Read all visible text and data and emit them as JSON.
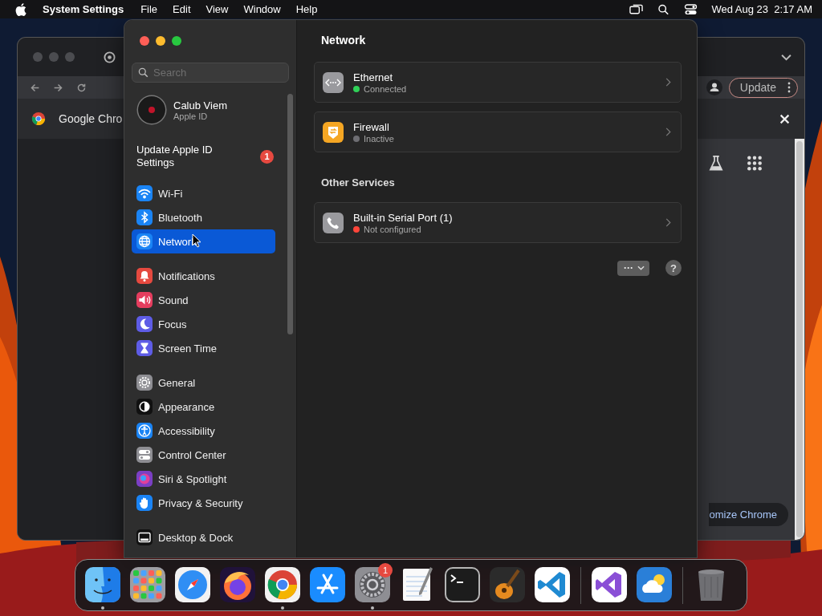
{
  "menu_bar": {
    "app_name": "System Settings",
    "menus": [
      "File",
      "Edit",
      "View",
      "Window",
      "Help"
    ],
    "clock": "Wed Aug 23  2:17 AM"
  },
  "browser_window": {
    "bookmark": "Google Chro",
    "update_button": "Update",
    "customize_button": "omize Chrome"
  },
  "settings": {
    "search": {
      "placeholder": "Search"
    },
    "account": {
      "name": "Calub Viem",
      "subtitle": "Apple ID"
    },
    "update_notice": {
      "label": "Update Apple ID Settings",
      "badge": "1"
    },
    "sidebar_groups": [
      [
        {
          "label": "Wi-Fi",
          "kind": "wifi",
          "color": "#1a84f5",
          "selected": false
        },
        {
          "label": "Bluetooth",
          "kind": "bluetooth",
          "color": "#1a84f5",
          "selected": false
        },
        {
          "label": "Network",
          "kind": "globe",
          "color": "#1a84f5",
          "selected": true
        }
      ],
      [
        {
          "label": "Notifications",
          "kind": "bell",
          "color": "#e5493f",
          "selected": false
        },
        {
          "label": "Sound",
          "kind": "speaker",
          "color": "#e53d5e",
          "selected": false
        },
        {
          "label": "Focus",
          "kind": "moon",
          "color": "#5e5ce6",
          "selected": false
        },
        {
          "label": "Screen Time",
          "kind": "hourglass",
          "color": "#5e5ce6",
          "selected": false
        }
      ],
      [
        {
          "label": "General",
          "kind": "gear",
          "color": "#8e8e93",
          "selected": false
        },
        {
          "label": "Appearance",
          "kind": "contrast",
          "color": "#111111",
          "selected": false
        },
        {
          "label": "Accessibility",
          "kind": "accessibility",
          "color": "#1a84f5",
          "selected": false
        },
        {
          "label": "Control Center",
          "kind": "toggles",
          "color": "#8e8e93",
          "selected": false
        },
        {
          "label": "Siri & Spotlight",
          "kind": "orb",
          "color": "#7b3fc4",
          "selected": false
        },
        {
          "label": "Privacy & Security",
          "kind": "hand",
          "color": "#1a84f5",
          "selected": false
        }
      ],
      [
        {
          "label": "Desktop & Dock",
          "kind": "dock",
          "color": "#111111",
          "selected": false
        }
      ]
    ],
    "page_title": "Network",
    "services": [
      {
        "name": "Ethernet",
        "status": "Connected",
        "color": "#30d158",
        "kind": "ethernet"
      },
      {
        "name": "Firewall",
        "status": "Inactive",
        "color": "#6e6e73",
        "kind": "shield"
      }
    ],
    "other_services_heading": "Other Services",
    "other_services": [
      {
        "name": "Built-in Serial Port (1)",
        "status": "Not configured",
        "color": "#ff453a",
        "kind": "phone"
      }
    ],
    "more_button": "···",
    "help_button": "?"
  },
  "dock": [
    {
      "kind": "finder",
      "running": true
    },
    {
      "kind": "launchpad",
      "running": false
    },
    {
      "kind": "safari",
      "running": false
    },
    {
      "kind": "firefox",
      "running": false
    },
    {
      "kind": "chrome",
      "running": true
    },
    {
      "kind": "appstore",
      "running": false
    },
    {
      "kind": "settings",
      "running": true,
      "badge": "1"
    },
    {
      "kind": "textedit",
      "running": false
    },
    {
      "kind": "terminal",
      "running": false
    },
    {
      "kind": "garageband",
      "running": false
    },
    {
      "kind": "vscode",
      "running": false
    },
    {
      "kind": "separator"
    },
    {
      "kind": "visualstudio",
      "running": false
    },
    {
      "kind": "weather",
      "running": false
    },
    {
      "kind": "separator"
    },
    {
      "kind": "trash",
      "running": false
    }
  ]
}
